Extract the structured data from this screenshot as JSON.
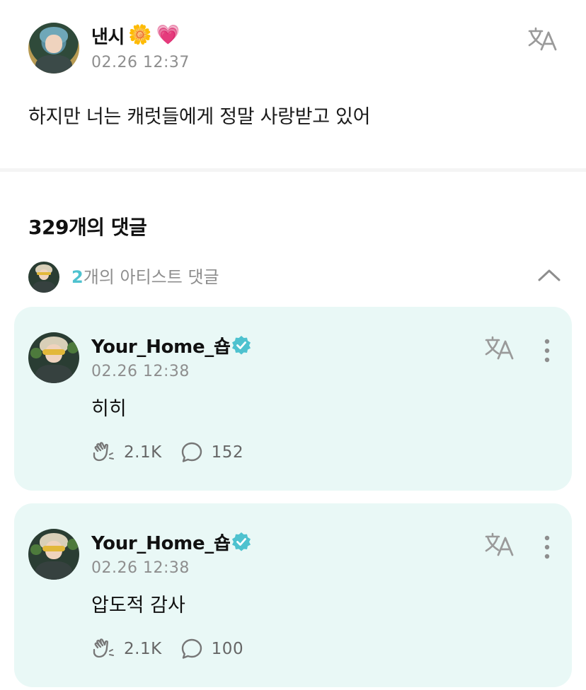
{
  "post": {
    "author": "낸시",
    "emoji": [
      "🌼",
      "💗"
    ],
    "time": "02.26 12:37",
    "body": "하지만 너는 캐럿들에게 정말 사랑받고 있어"
  },
  "comments_header": {
    "count_label": "329개의 댓글"
  },
  "artist_comments": {
    "count": "2",
    "label_suffix": "개의 아티스트 댓글"
  },
  "comments": [
    {
      "author": "Your_Home_숍",
      "time": "02.26 12:38",
      "text": "히히",
      "likes": "2.1K",
      "replies": "152"
    },
    {
      "author": "Your_Home_숍",
      "time": "02.26 12:38",
      "text": "압도적 감사",
      "likes": "2.1K",
      "replies": "100"
    }
  ],
  "colors": {
    "accent": "#4ec2cf",
    "card_background": "#e9f8f6",
    "muted_text": "#8e8e8e"
  },
  "icons": {
    "translate": "translate-icon",
    "verified": "verified-badge-icon",
    "more": "more-vertical-icon",
    "like": "clap-like-icon",
    "reply": "speech-bubble-icon",
    "collapse": "chevron-up-icon"
  }
}
